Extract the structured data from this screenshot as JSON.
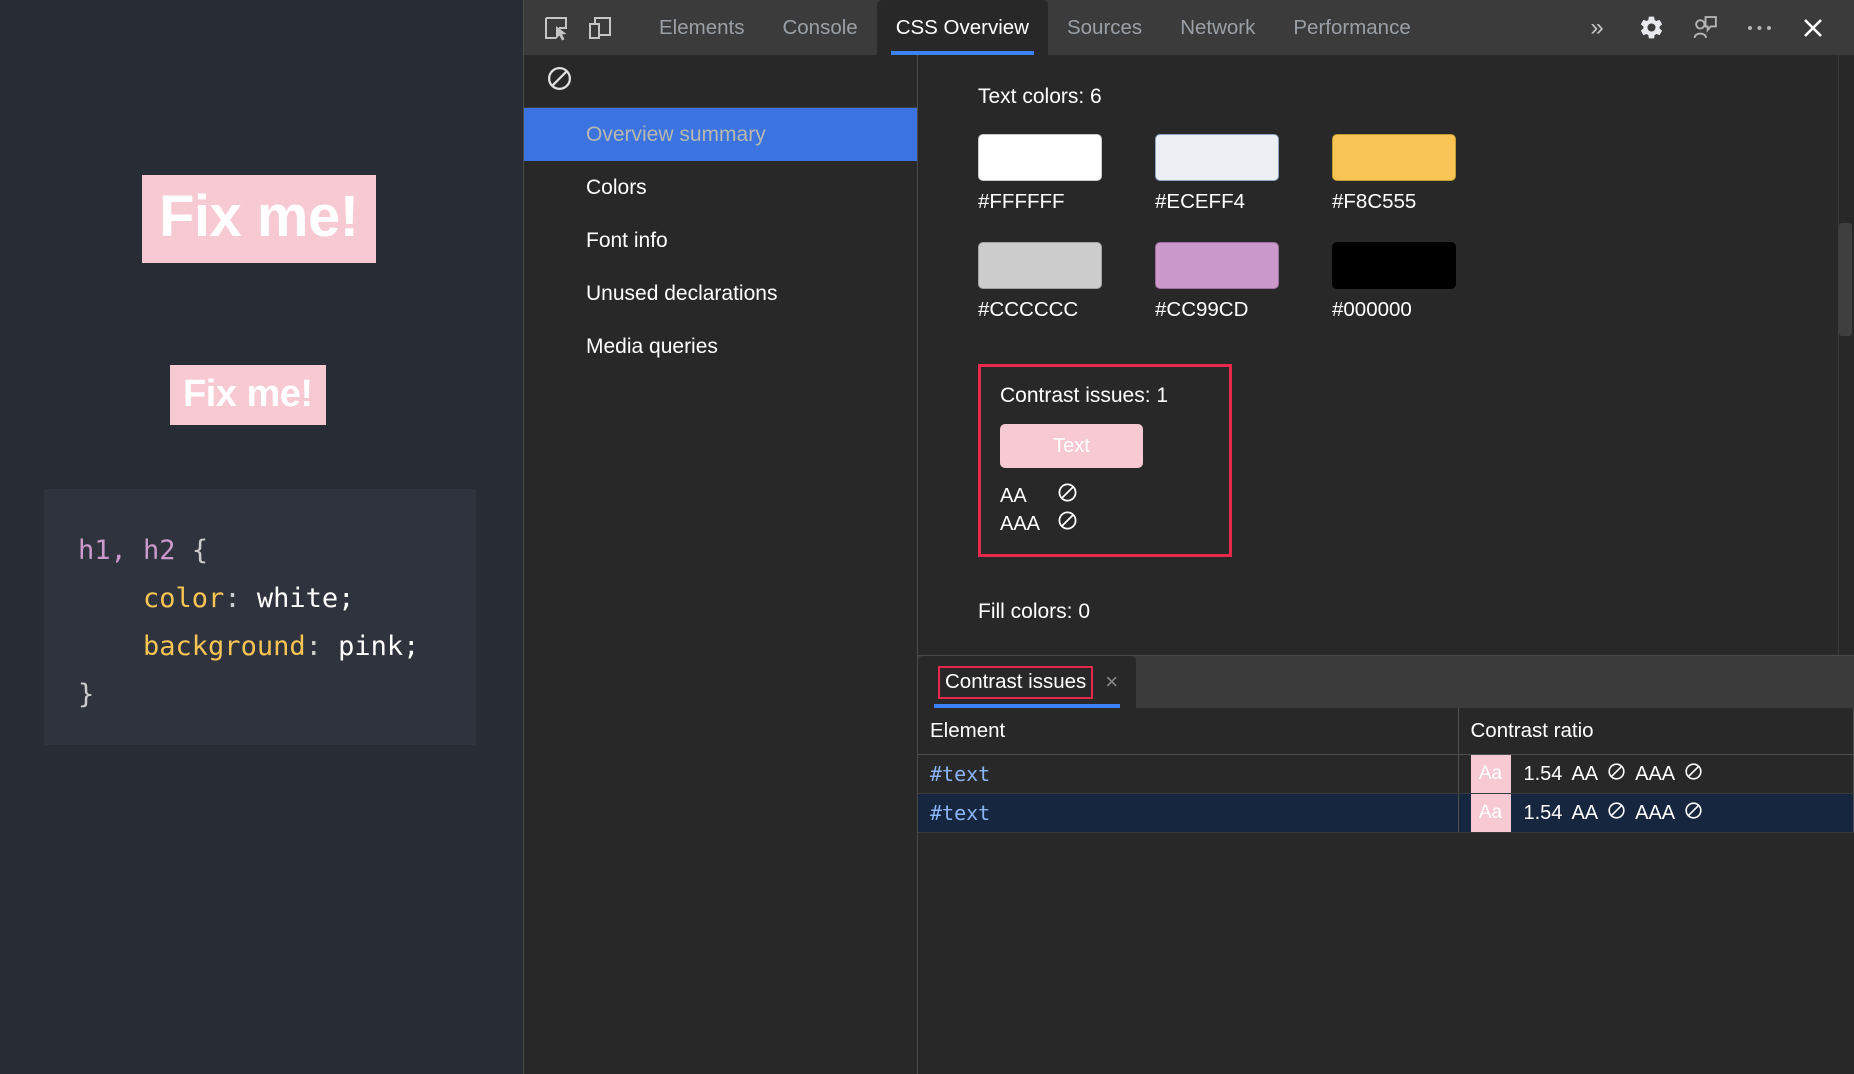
{
  "page": {
    "heading1": "Fix me!",
    "heading2": "Fix me!",
    "code": {
      "selector": "h1, h2",
      "open_brace": "{",
      "prop1": "color",
      "val1": "white;",
      "prop2": "background",
      "val2": "pink;",
      "close_brace": "}",
      "colon": ": "
    },
    "background_color": "#282C34",
    "heading_bg": "#F7C9D3",
    "heading_color": "#FFFFFF"
  },
  "devtools": {
    "toolbar": {
      "inspect_icon": "inspect-element-icon",
      "device_icon": "device-toolbar-icon",
      "more_tabs": "»",
      "settings_icon": "gear-icon",
      "feedback_icon": "feedback-icon",
      "more_icon": "more-options-icon",
      "close_icon": "close-icon"
    },
    "tabs": [
      {
        "label": "Elements",
        "active": false
      },
      {
        "label": "Console",
        "active": false
      },
      {
        "label": "CSS Overview",
        "active": true
      },
      {
        "label": "Sources",
        "active": false
      },
      {
        "label": "Network",
        "active": false
      },
      {
        "label": "Performance",
        "active": false
      }
    ],
    "sidebar": {
      "clear_icon": "no-entry-icon",
      "items": [
        {
          "label": "Overview summary",
          "selected": true
        },
        {
          "label": "Colors",
          "selected": false
        },
        {
          "label": "Font info",
          "selected": false
        },
        {
          "label": "Unused declarations",
          "selected": false
        },
        {
          "label": "Media queries",
          "selected": false
        }
      ]
    },
    "overview": {
      "text_colors_title": "Text colors: 6",
      "swatches": [
        {
          "hex": "#FFFFFF",
          "label": "#FFFFFF"
        },
        {
          "hex": "#ECEFF4",
          "label": "#ECEFF4"
        },
        {
          "hex": "#F8C555",
          "label": "#F8C555"
        },
        {
          "hex": "#CCCCCC",
          "label": "#CCCCCC"
        },
        {
          "hex": "#CC99CD",
          "label": "#CC99CD"
        },
        {
          "hex": "#000000",
          "label": "#000000"
        }
      ],
      "contrast_card": {
        "title": "Contrast issues: 1",
        "chip_text": "Text",
        "chip_bg": "#F7C9D3",
        "chip_color": "#FFFFFF",
        "aa_label": "AA",
        "aa_status": "fail",
        "aaa_label": "AAA",
        "aaa_status": "fail",
        "highlight_color": "#E8294B"
      },
      "fill_colors_title": "Fill colors: 0"
    },
    "drawer": {
      "tab_label": "Contrast issues",
      "close_label": "×",
      "columns": [
        "Element",
        "Contrast ratio"
      ],
      "rows": [
        {
          "element": "#text",
          "chip": "Aa",
          "ratio": "1.54",
          "aa_label": "AA",
          "aa_status": "fail",
          "aaa_label": "AAA",
          "aaa_status": "fail",
          "selected": false
        },
        {
          "element": "#text",
          "chip": "Aa",
          "ratio": "1.54",
          "aa_label": "AA",
          "aa_status": "fail",
          "aaa_label": "AAA",
          "aaa_status": "fail",
          "selected": true
        }
      ]
    }
  }
}
